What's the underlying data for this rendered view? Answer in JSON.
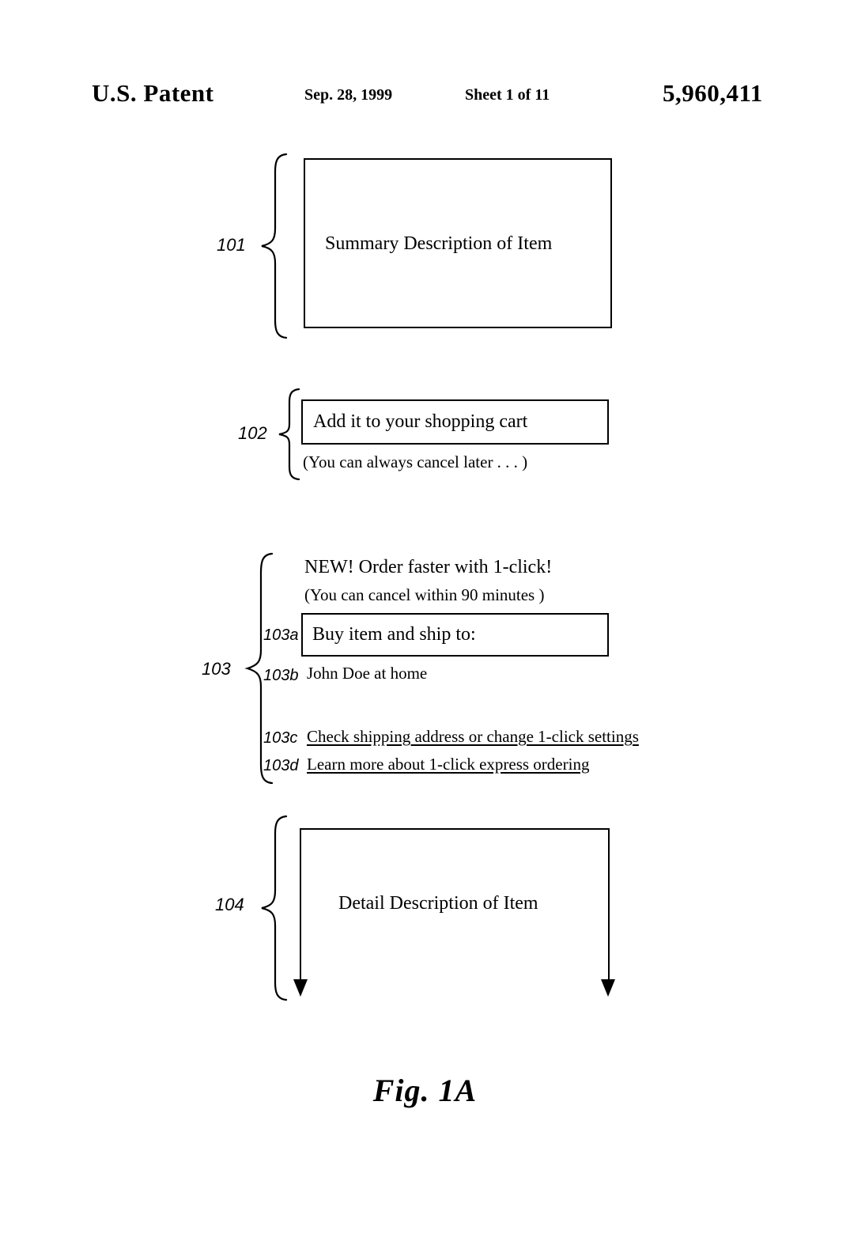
{
  "header": {
    "office": "U.S. Patent",
    "date": "Sep. 28, 1999",
    "sheet": "Sheet 1 of 11",
    "patent_number": "5,960,411"
  },
  "figure": {
    "caption": "Fig. 1A",
    "ink_color": "#000000",
    "background_color": "#ffffff"
  },
  "sections": {
    "s101": {
      "ref": "101",
      "box_text": "Summary Description of Item"
    },
    "s102": {
      "ref": "102",
      "box_text": "Add it to your shopping cart",
      "note": "(You can always cancel later . . . )"
    },
    "s103": {
      "ref": "103",
      "promo_heading": "NEW!  Order faster with 1-click!",
      "promo_note": "(You can cancel within 90 minutes )",
      "items": [
        {
          "ref": "103a",
          "text": "Buy item and ship to:",
          "style": "box"
        },
        {
          "ref": "103b",
          "text": "John Doe at home",
          "style": "plain"
        },
        {
          "ref": "103c",
          "text": "Check shipping address or change 1-click settings",
          "style": "link"
        },
        {
          "ref": "103d",
          "text": "Learn more about 1-click express ordering",
          "style": "link"
        }
      ]
    },
    "s104": {
      "ref": "104",
      "box_text": "Detail Description of Item"
    }
  }
}
